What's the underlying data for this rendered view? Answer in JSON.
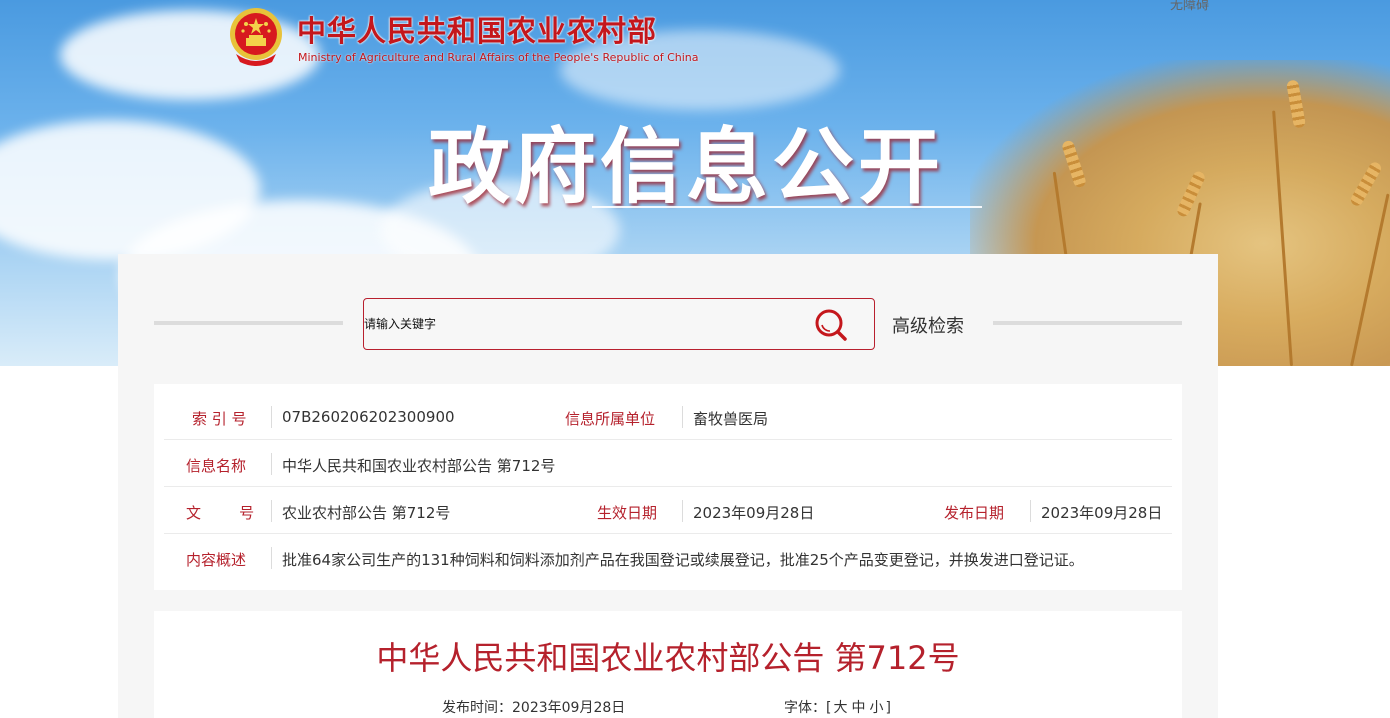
{
  "header": {
    "accessibility_label": "无障碍",
    "site_name_cn": "中华人民共和国农业农村部",
    "site_name_en": "Ministry of Agriculture and Rural Affairs of the People's Republic of China",
    "hero_title": "政府信息公开",
    "logo_icon": "national-emblem-icon"
  },
  "search": {
    "placeholder": "请输入关键字",
    "button_icon": "search-icon",
    "advanced_label": "高级检索"
  },
  "info": {
    "index_label": "索 引 号",
    "index_value": "07B260206202300900",
    "unit_label": "信息所属单位",
    "unit_value": "畜牧兽医局",
    "name_label": "信息名称",
    "name_value": "中华人民共和国农业农村部公告 第712号",
    "doc_label": "文        号",
    "doc_value": "农业农村部公告 第712号",
    "effective_label": "生效日期",
    "effective_value": "2023年09月28日",
    "publish_label": "发布日期",
    "publish_value": "2023年09月28日",
    "summary_label": "内容概述",
    "summary_value": "批准64家公司生产的131种饲料和饲料添加剂产品在我国登记或续展登记，批准25个产品变更登记，并换发进口登记证。"
  },
  "article": {
    "title": "中华人民共和国农业农村部公告 第712号",
    "publish_time": "发布时间：2023年09月28日",
    "font_label": "字体：[",
    "font_large": "大",
    "font_medium": "中",
    "font_small": "小",
    "font_close": "]"
  },
  "colors": {
    "accent": "#b5212c",
    "brand_red": "#c4171c"
  }
}
